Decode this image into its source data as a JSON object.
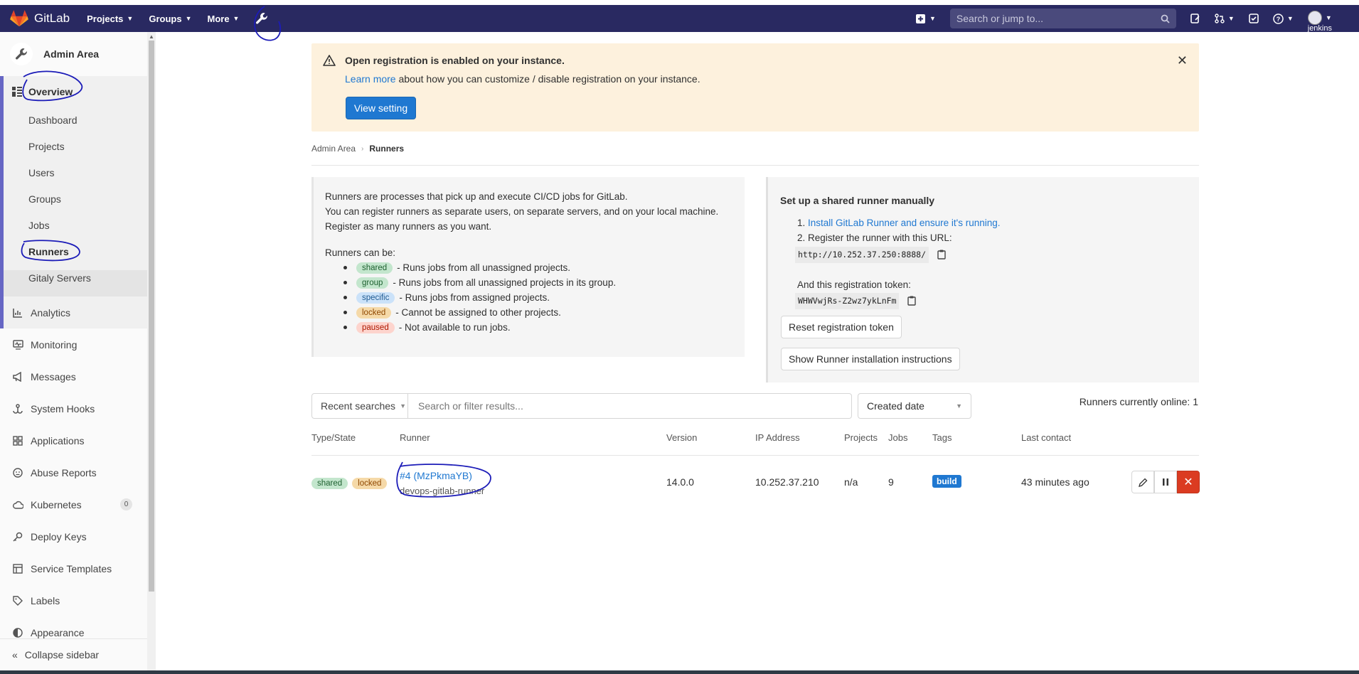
{
  "navbar": {
    "brand": "GitLab",
    "menu": [
      {
        "label": "Projects"
      },
      {
        "label": "Groups"
      },
      {
        "label": "More"
      }
    ],
    "search_placeholder": "Search or jump to...",
    "user": "jenkins"
  },
  "sidebar": {
    "title": "Admin Area",
    "overview": "Overview",
    "overview_items": [
      "Dashboard",
      "Projects",
      "Users",
      "Groups",
      "Jobs",
      "Runners",
      "Gitaly Servers"
    ],
    "items": [
      {
        "label": "Analytics",
        "icon": "chart-icon"
      },
      {
        "label": "Monitoring",
        "icon": "monitor-icon"
      },
      {
        "label": "Messages",
        "icon": "bullhorn-icon"
      },
      {
        "label": "System Hooks",
        "icon": "hook-icon"
      },
      {
        "label": "Applications",
        "icon": "grid-icon"
      },
      {
        "label": "Abuse Reports",
        "icon": "smiley-icon",
        "count": "0"
      },
      {
        "label": "Kubernetes",
        "icon": "cloud-icon"
      },
      {
        "label": "Deploy Keys",
        "icon": "key-icon"
      },
      {
        "label": "Service Templates",
        "icon": "template-icon"
      },
      {
        "label": "Labels",
        "icon": "label-icon"
      },
      {
        "label": "Appearance",
        "icon": "appearance-icon"
      }
    ],
    "collapse": "Collapse sidebar"
  },
  "banner": {
    "title": "Open registration is enabled on your instance.",
    "link": "Learn more",
    "text": " about how you can customize / disable registration on your instance.",
    "button": "View setting"
  },
  "breadcrumb": {
    "parent": "Admin Area",
    "current": "Runners"
  },
  "info": {
    "line1": "Runners are processes that pick up and execute CI/CD jobs for GitLab.",
    "line2": "You can register runners as separate users, on separate servers, and on your local machine.",
    "line3": "Register as many runners as you want.",
    "can_be": "Runners can be:",
    "types": [
      {
        "tag": "shared",
        "desc": "- Runs jobs from all unassigned projects."
      },
      {
        "tag": "group",
        "desc": "- Runs jobs from all unassigned projects in its group."
      },
      {
        "tag": "specific",
        "desc": "- Runs jobs from assigned projects."
      },
      {
        "tag": "locked",
        "desc": "- Cannot be assigned to other projects."
      },
      {
        "tag": "paused",
        "desc": "- Not available to run jobs."
      }
    ]
  },
  "setup": {
    "title": "Set up a shared runner manually",
    "step1_num": "1.",
    "step1_link": "Install GitLab Runner and ensure it's running.",
    "step2_num": "2.",
    "step2": "Register the runner with this URL:",
    "url": "http://10.252.37.250:8888/",
    "token_label": "And this registration token:",
    "token": "WHWVwjRs-Z2wz7ykLnFm",
    "reset_button": "Reset registration token",
    "instructions_button": "Show Runner installation instructions"
  },
  "filter": {
    "recent": "Recent searches",
    "placeholder": "Search or filter results...",
    "sort": "Created date",
    "online": "Runners currently online: 1"
  },
  "table": {
    "headers": [
      "Type/State",
      "Runner",
      "Version",
      "IP Address",
      "Projects",
      "Jobs",
      "Tags",
      "Last contact"
    ],
    "rows": [
      {
        "states": [
          "shared",
          "locked"
        ],
        "runner": "#4 (MzPkmaYB)",
        "description": "devops-gitlab-runner",
        "version": "14.0.0",
        "ip": "10.252.37.210",
        "projects": "n/a",
        "jobs": "9",
        "tag": "build",
        "last_contact": "43 minutes ago"
      }
    ]
  },
  "colors": {
    "navbar": "#292961",
    "link": "#1f78d1",
    "danger": "#db3b21",
    "banner": "#fdf1dd"
  }
}
